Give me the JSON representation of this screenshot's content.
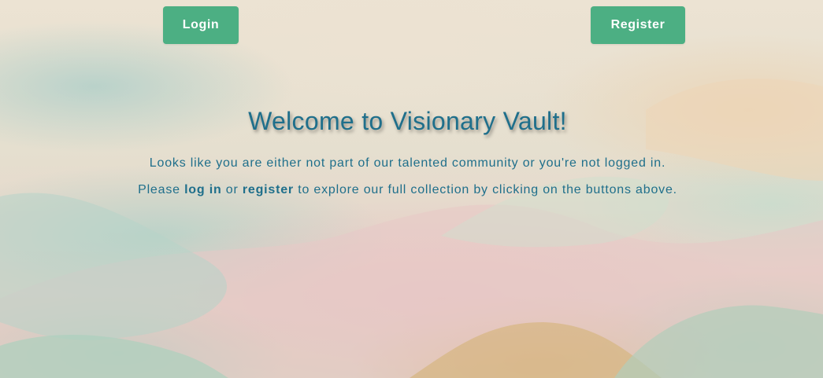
{
  "header": {
    "login_label": "Login",
    "register_label": "Register"
  },
  "main": {
    "title": "Welcome to Visionary Vault!",
    "line1": "Looks like you are either not part of our talented community or you're not logged in.",
    "line2": {
      "prefix": "Please ",
      "login_link": "log in",
      "middle": " or ",
      "register_link": "register",
      "suffix": " to explore our full collection by clicking on the buttons above."
    }
  },
  "colors": {
    "button_bg": "#4caf83",
    "button_text": "#ffffff",
    "text_accent": "#1f6f8b"
  }
}
